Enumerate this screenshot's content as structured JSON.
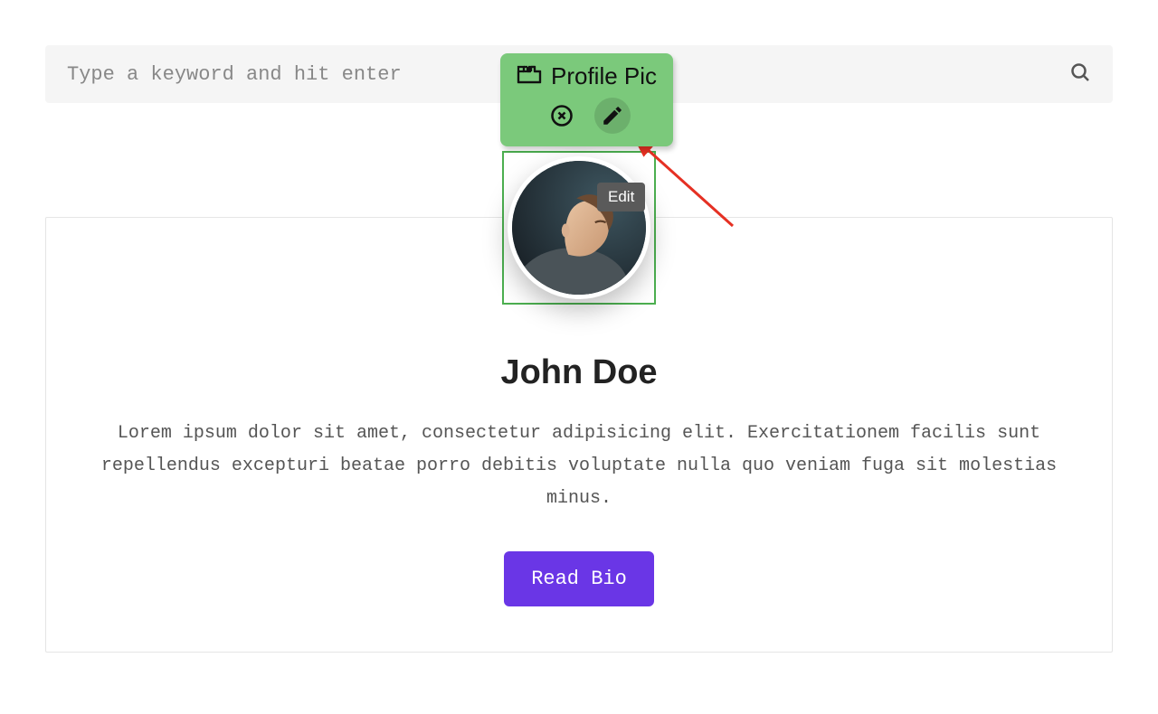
{
  "search": {
    "placeholder": "Type a keyword and hit enter"
  },
  "badge": {
    "title": "Profile Pic"
  },
  "tooltip": {
    "edit": "Edit"
  },
  "profile": {
    "name": "John Doe",
    "description": "Lorem ipsum dolor sit amet, consectetur adipisicing elit. Exercitationem facilis sunt repellendus excepturi beatae porro debitis voluptate nulla quo veniam fuga sit molestias minus.",
    "button": "Read Bio"
  }
}
